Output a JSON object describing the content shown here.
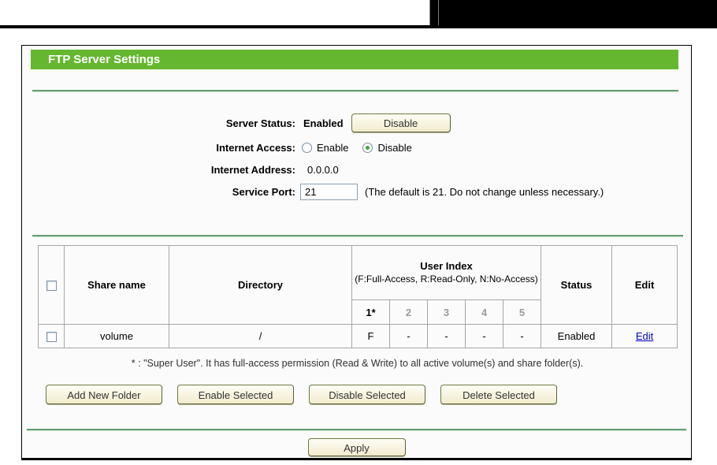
{
  "page": {
    "title": "FTP Server Settings"
  },
  "form": {
    "server_status": {
      "label": "Server Status:",
      "value": "Enabled",
      "button_label": "Disable"
    },
    "internet_access": {
      "label": "Internet Access:",
      "enable_label": "Enable",
      "disable_label": "Disable",
      "selected": "Disable"
    },
    "internet_address": {
      "label": "Internet Address:",
      "value": "0.0.0.0"
    },
    "service_port": {
      "label": "Service Port:",
      "value": "21",
      "note": "(The default is 21. Do not change unless necessary.)"
    }
  },
  "table": {
    "headers": {
      "share_name": "Share name",
      "directory": "Directory",
      "user_index_title": "User Index",
      "user_index_subtitle": "(F:Full-Access, R:Read-Only, N:No-Access)",
      "user_columns": [
        "1*",
        "2",
        "3",
        "4",
        "5"
      ],
      "status": "Status",
      "edit": "Edit"
    },
    "rows": [
      {
        "share_name": "volume",
        "directory": "/",
        "user_access": [
          "F",
          "-",
          "-",
          "-",
          "-"
        ],
        "status": "Enabled",
        "edit_label": "Edit"
      }
    ]
  },
  "footnote": "* : \"Super User\". It has full-access permission (Read & Write) to all active volume(s) and share folder(s).",
  "buttons": {
    "add_new_folder": "Add New Folder",
    "enable_selected": "Enable Selected",
    "disable_selected": "Disable Selected",
    "delete_selected": "Delete Selected",
    "apply": "Apply"
  },
  "colors": {
    "header_green": "#65b72f",
    "separator_green": "#679e74",
    "button_border": "#6b7c40",
    "link_blue": "#0000cc",
    "radio_selected_dot": "#3fa53f"
  }
}
